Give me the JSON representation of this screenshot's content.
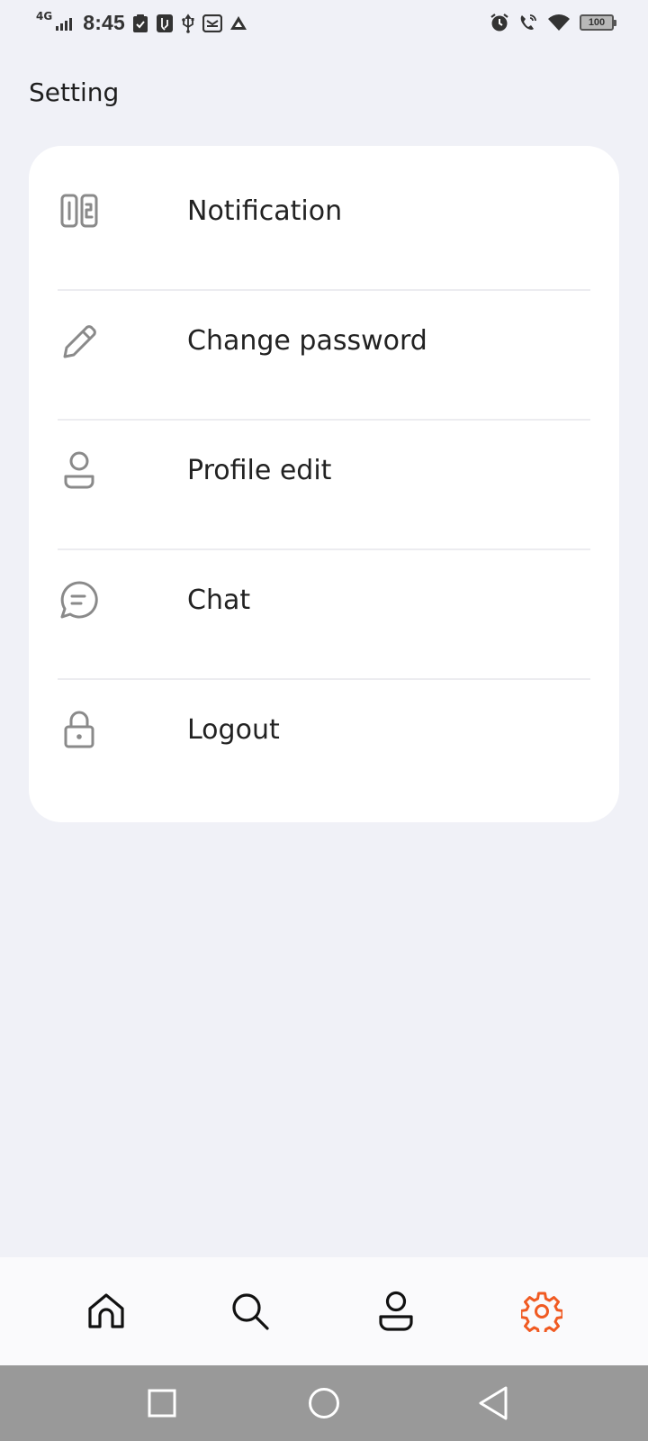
{
  "status_bar": {
    "network": "4G",
    "time": "8:45",
    "battery": "100"
  },
  "page": {
    "title": "Setting"
  },
  "menu": {
    "items": [
      {
        "label": "Notification",
        "icon": "notification-toggle-icon"
      },
      {
        "label": "Change password",
        "icon": "pencil-icon"
      },
      {
        "label": "Profile edit",
        "icon": "user-icon"
      },
      {
        "label": "Chat",
        "icon": "chat-bubble-icon"
      },
      {
        "label": "Logout",
        "icon": "lock-icon"
      }
    ]
  },
  "bottom_nav": {
    "items": [
      "home-icon",
      "search-icon",
      "profile-icon",
      "settings-gear-icon"
    ],
    "active": "settings",
    "active_color": "#f05a22"
  },
  "colors": {
    "background": "#f0f1f7",
    "card": "#ffffff",
    "icon_gray": "#8a8a8a",
    "system_nav": "#999999"
  }
}
